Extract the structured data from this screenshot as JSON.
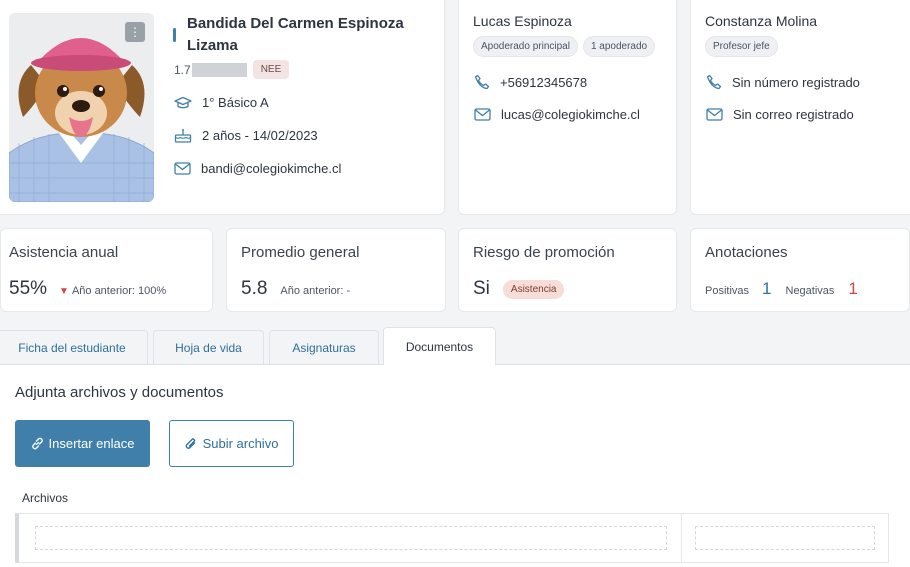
{
  "student": {
    "name": "Bandida Del Carmen Espinoza Lizama",
    "rut_partial": "1.7",
    "tag": "NEE",
    "grade": "1° Básico A",
    "age": "2 años - 14/02/2023",
    "email": "bandi@colegiokimche.cl"
  },
  "guardian": {
    "name": "Lucas Espinoza",
    "badges": [
      "Apoderado principal",
      "1 apoderado"
    ],
    "phone": "+56912345678",
    "email": "lucas@colegiokimche.cl"
  },
  "teacher": {
    "name": "Constanza Molina",
    "badge": "Profesor jefe",
    "phone": "Sin número registrado",
    "email": "Sin correo registrado"
  },
  "stats": {
    "attendance": {
      "title": "Asistencia anual",
      "value": "55%",
      "prev": "Año anterior: 100%"
    },
    "average": {
      "title": "Promedio general",
      "value": "5.8",
      "prev": "Año anterior: -"
    },
    "risk": {
      "title": "Riesgo de promoción",
      "value": "Si",
      "badge": "Asistencia"
    },
    "notes": {
      "title": "Anotaciones",
      "pos_label": "Positivas",
      "pos_value": "1",
      "neg_label": "Negativas",
      "neg_value": "1"
    }
  },
  "tabs": [
    "Ficha del estudiante",
    "Hoja de vida",
    "Asignaturas",
    "Documentos"
  ],
  "documents": {
    "heading": "Adjunta archivos y documentos",
    "insert_link_label": "Insertar enlace",
    "upload_label": "Subir archivo",
    "files_label": "Archivos"
  },
  "colors": {
    "primary": "#3f7fa9",
    "danger": "#d64545",
    "positive": "#2f6f9e"
  }
}
